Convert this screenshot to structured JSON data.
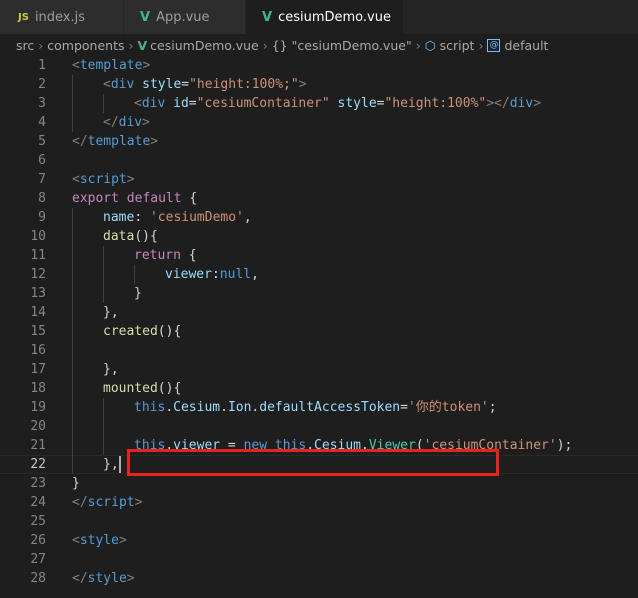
{
  "tabs": [
    {
      "icon": "JS",
      "label": "index.js"
    },
    {
      "icon": "V",
      "label": "App.vue"
    },
    {
      "icon": "V",
      "label": "cesiumDemo.vue",
      "active": true
    }
  ],
  "breadcrumb": {
    "src": "src",
    "components": "components",
    "file": "cesiumDemo.vue",
    "braces": "{}",
    "object": "\"cesiumDemo.vue\"",
    "script": "script",
    "default": "default"
  },
  "lines": [
    {
      "n": "1",
      "indent": 0,
      "tokens": [
        [
          "tag",
          "<"
        ],
        [
          "tname",
          "template"
        ],
        [
          "tag",
          ">"
        ]
      ]
    },
    {
      "n": "2",
      "indent": 1,
      "tokens": [
        [
          "tag",
          "<"
        ],
        [
          "tname",
          "div"
        ],
        [
          "plain",
          " "
        ],
        [
          "attr",
          "style"
        ],
        [
          "plain",
          "="
        ],
        [
          "str",
          "\"height:100%;\""
        ],
        [
          "tag",
          ">"
        ]
      ]
    },
    {
      "n": "3",
      "indent": 2,
      "tokens": [
        [
          "tag",
          "<"
        ],
        [
          "tname",
          "div"
        ],
        [
          "plain",
          " "
        ],
        [
          "attr",
          "id"
        ],
        [
          "plain",
          "="
        ],
        [
          "str",
          "\"cesiumContainer\""
        ],
        [
          "plain",
          " "
        ],
        [
          "attr",
          "style"
        ],
        [
          "plain",
          "="
        ],
        [
          "str",
          "\"height:100%\""
        ],
        [
          "tag",
          "></"
        ],
        [
          "tname",
          "div"
        ],
        [
          "tag",
          ">"
        ]
      ]
    },
    {
      "n": "4",
      "indent": 1,
      "tokens": [
        [
          "tag",
          "</"
        ],
        [
          "tname",
          "div"
        ],
        [
          "tag",
          ">"
        ]
      ]
    },
    {
      "n": "5",
      "indent": 0,
      "tokens": [
        [
          "tag",
          "</"
        ],
        [
          "tname",
          "template"
        ],
        [
          "tag",
          ">"
        ]
      ]
    },
    {
      "n": "6",
      "indent": 0,
      "tokens": []
    },
    {
      "n": "7",
      "indent": 0,
      "tokens": [
        [
          "tag",
          "<"
        ],
        [
          "tname",
          "script"
        ],
        [
          "tag",
          ">"
        ]
      ]
    },
    {
      "n": "8",
      "indent": 0,
      "tokens": [
        [
          "kw",
          "export"
        ],
        [
          "plain",
          " "
        ],
        [
          "kw",
          "default"
        ],
        [
          "plain",
          " {"
        ]
      ]
    },
    {
      "n": "9",
      "indent": 1,
      "tokens": [
        [
          "prop",
          "name"
        ],
        [
          "plain",
          ": "
        ],
        [
          "str",
          "'cesiumDemo'"
        ],
        [
          "plain",
          ","
        ]
      ]
    },
    {
      "n": "10",
      "indent": 1,
      "tokens": [
        [
          "fn",
          "data"
        ],
        [
          "plain",
          "(){"
        ]
      ]
    },
    {
      "n": "11",
      "indent": 2,
      "tokens": [
        [
          "kw",
          "return"
        ],
        [
          "plain",
          " {"
        ]
      ]
    },
    {
      "n": "12",
      "indent": 3,
      "tokens": [
        [
          "prop",
          "viewer"
        ],
        [
          "plain",
          ":"
        ],
        [
          "kwb",
          "null"
        ],
        [
          "plain",
          ","
        ]
      ]
    },
    {
      "n": "13",
      "indent": 2,
      "tokens": [
        [
          "plain",
          "}"
        ]
      ]
    },
    {
      "n": "14",
      "indent": 1,
      "tokens": [
        [
          "plain",
          "},"
        ]
      ]
    },
    {
      "n": "15",
      "indent": 1,
      "tokens": [
        [
          "fn",
          "created"
        ],
        [
          "plain",
          "(){"
        ]
      ]
    },
    {
      "n": "16",
      "indent": 0,
      "tokens": []
    },
    {
      "n": "17",
      "indent": 1,
      "tokens": [
        [
          "plain",
          "},"
        ]
      ]
    },
    {
      "n": "18",
      "indent": 1,
      "tokens": [
        [
          "fn",
          "mounted"
        ],
        [
          "plain",
          "(){"
        ]
      ]
    },
    {
      "n": "19",
      "indent": 2,
      "tokens": [
        [
          "kwb",
          "this"
        ],
        [
          "plain",
          "."
        ],
        [
          "prop",
          "Cesium"
        ],
        [
          "plain",
          "."
        ],
        [
          "prop",
          "Ion"
        ],
        [
          "plain",
          "."
        ],
        [
          "prop",
          "defaultAccessToken"
        ],
        [
          "plain",
          "="
        ],
        [
          "str",
          "'你的token'"
        ],
        [
          "plain",
          ";"
        ]
      ]
    },
    {
      "n": "20",
      "indent": 0,
      "tokens": []
    },
    {
      "n": "21",
      "indent": 2,
      "tokens": [
        [
          "kwb",
          "this"
        ],
        [
          "plain",
          "."
        ],
        [
          "prop",
          "viewer"
        ],
        [
          "plain",
          " = "
        ],
        [
          "kwb",
          "new"
        ],
        [
          "plain",
          " "
        ],
        [
          "kwb",
          "this"
        ],
        [
          "plain",
          "."
        ],
        [
          "prop",
          "Cesium"
        ],
        [
          "plain",
          "."
        ],
        [
          "cls",
          "Viewer"
        ],
        [
          "plain",
          "("
        ],
        [
          "str",
          "'cesiumContainer'"
        ],
        [
          "plain",
          ");"
        ]
      ]
    },
    {
      "n": "22",
      "indent": 1,
      "tokens": [
        [
          "plain",
          "},"
        ]
      ],
      "current": true
    },
    {
      "n": "23",
      "indent": 0,
      "tokens": [
        [
          "plain",
          "}"
        ]
      ]
    },
    {
      "n": "24",
      "indent": 0,
      "tokens": [
        [
          "tag",
          "</"
        ],
        [
          "tname",
          "script"
        ],
        [
          "tag",
          ">"
        ]
      ]
    },
    {
      "n": "25",
      "indent": 0,
      "tokens": []
    },
    {
      "n": "26",
      "indent": 0,
      "tokens": [
        [
          "tag",
          "<"
        ],
        [
          "tname",
          "style"
        ],
        [
          "tag",
          ">"
        ]
      ]
    },
    {
      "n": "27",
      "indent": 0,
      "tokens": []
    },
    {
      "n": "28",
      "indent": 0,
      "tokens": [
        [
          "tag",
          "</"
        ],
        [
          "tname",
          "style"
        ],
        [
          "tag",
          ">"
        ]
      ]
    }
  ],
  "colors": {
    "editor_bg": "#1e1e1e",
    "tab_bg": "#2d2d2d",
    "annotation_box": "#e8231d",
    "vue_green": "#41b883"
  }
}
